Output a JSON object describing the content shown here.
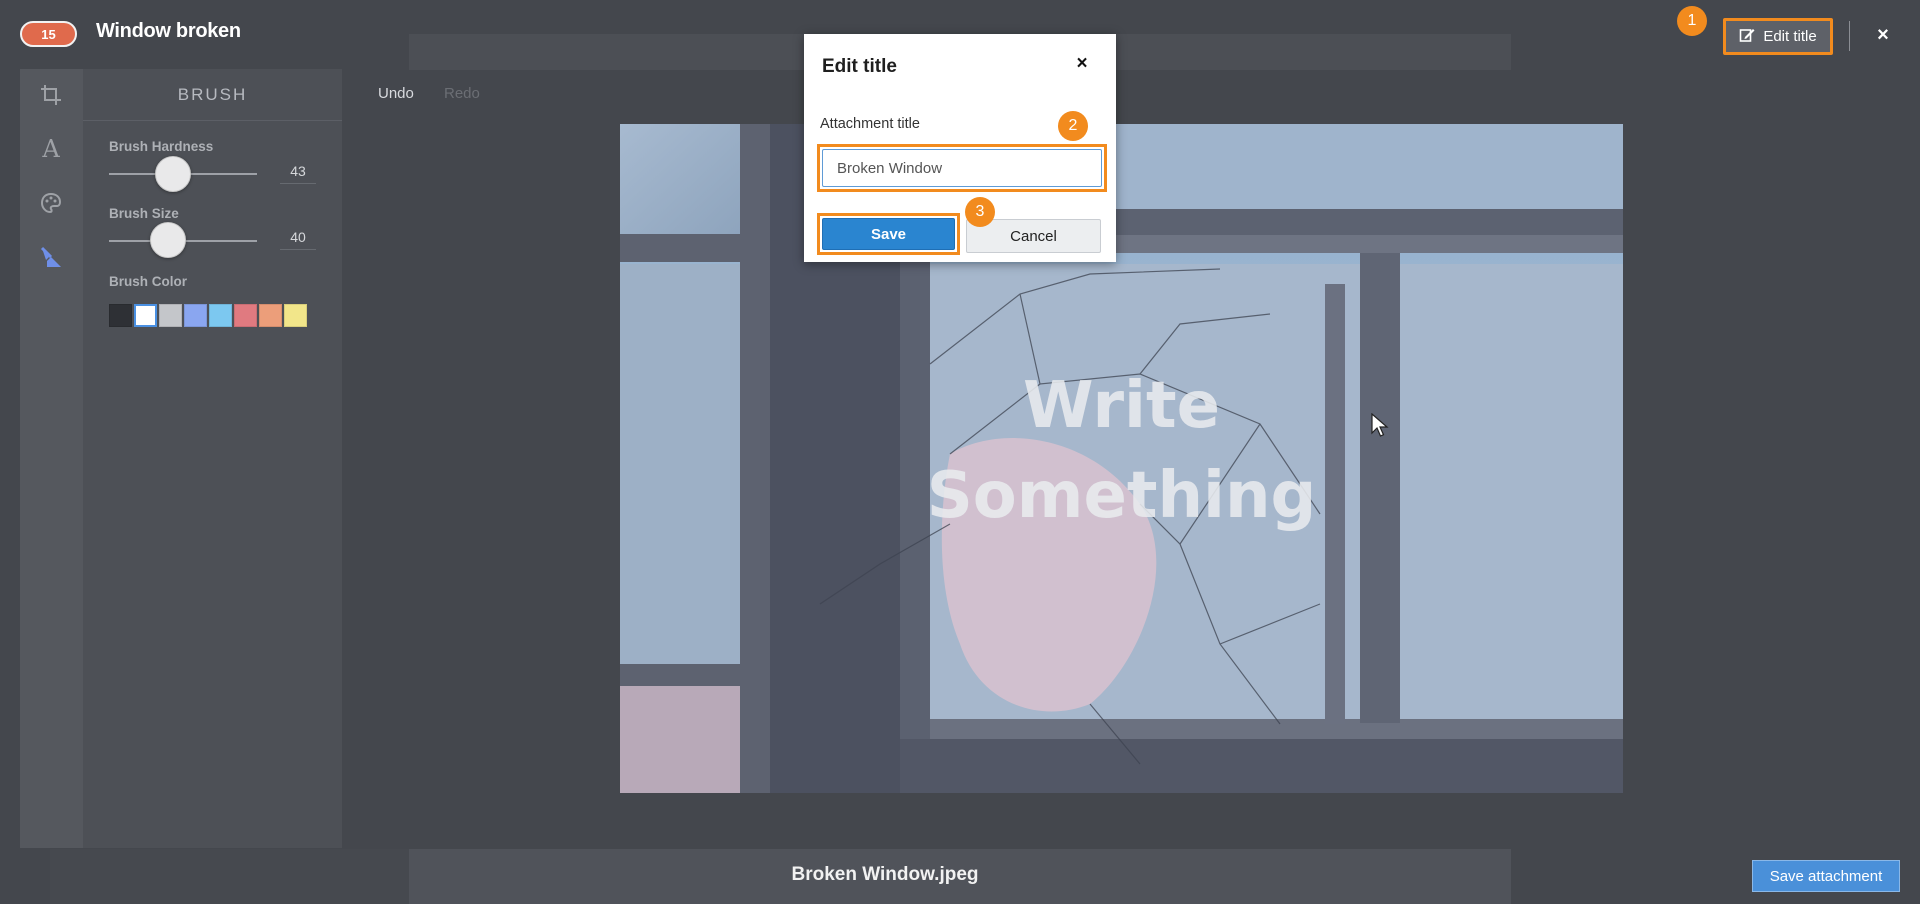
{
  "card": {
    "count": "15",
    "title": "Window broken"
  },
  "topbar": {
    "edit_title_label": "Edit title",
    "close_label": "×"
  },
  "steps": {
    "one": "1",
    "two": "2",
    "three": "3"
  },
  "tools": [
    {
      "name": "crop-icon"
    },
    {
      "name": "text-icon"
    },
    {
      "name": "palette-icon"
    },
    {
      "name": "brush-icon",
      "active": true
    }
  ],
  "brush": {
    "header": "BRUSH",
    "hardness_label": "Brush Hardness",
    "hardness_value": "43",
    "hardness_fraction": 0.43,
    "size_label": "Brush Size",
    "size_value": "40",
    "size_fraction": 0.4,
    "color_label": "Brush Color",
    "colors": [
      "#2e3035",
      "#ffffff",
      "#c4c6ca",
      "#8aa6f0",
      "#7cc8f0",
      "#e07a80",
      "#ec9e7a",
      "#f2e68a"
    ],
    "selected_color_index": 1
  },
  "history": {
    "undo": "Undo",
    "redo": "Redo"
  },
  "canvas": {
    "text_line1": "Write",
    "text_line2": "Something"
  },
  "footer": {
    "file_name": "Broken Window.jpeg",
    "save_attachment": "Save attachment"
  },
  "dialog": {
    "title": "Edit title",
    "close": "×",
    "label": "Attachment title",
    "input_value": "Broken Window",
    "save": "Save",
    "cancel": "Cancel"
  },
  "colors": {
    "accent_orange": "#f28b1e",
    "badge_red": "#e06a4c",
    "primary_blue": "#2a85d0"
  }
}
